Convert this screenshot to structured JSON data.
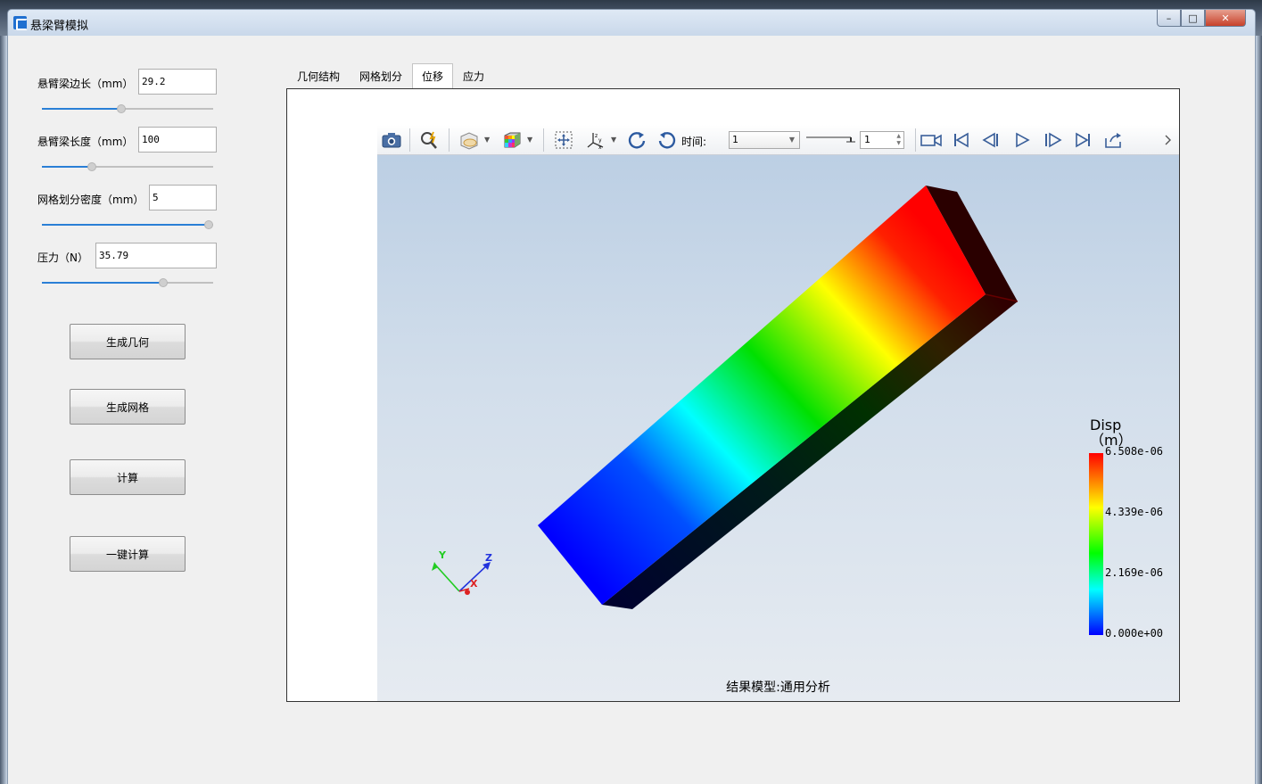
{
  "window": {
    "title": "悬梁臂模拟",
    "controls": {
      "minimize": "–",
      "maximize": "□",
      "close": "✕"
    }
  },
  "params": [
    {
      "label": "悬臂梁边长（mm）",
      "value": "29.2",
      "slider_fraction": 0.46
    },
    {
      "label": "悬臂梁长度（mm）",
      "value": "100",
      "slider_fraction": 0.28
    },
    {
      "label": "网格划分密度（mm）",
      "value": "5",
      "slider_fraction": 1.0
    },
    {
      "label": "压力（N）",
      "value": "35.79",
      "slider_fraction": 0.72
    }
  ],
  "buttons": {
    "gen_geometry": "生成几何",
    "gen_mesh": "生成网格",
    "compute": "计算",
    "one_click": "一键计算"
  },
  "tabs": [
    {
      "label": "几何结构",
      "active": false
    },
    {
      "label": "网格划分",
      "active": false
    },
    {
      "label": "位移",
      "active": true
    },
    {
      "label": "应力",
      "active": false
    }
  ],
  "toolbar": {
    "time_label": "时间:",
    "time_value": "1",
    "time_spin": "1"
  },
  "viewer": {
    "caption": "结果模型:通用分析",
    "axes": {
      "x": "X",
      "y": "Y",
      "z": "Z"
    }
  },
  "legend": {
    "title_line1": "Disp",
    "title_line2": "（m）",
    "ticks": [
      "6.508e-06",
      "4.339e-06",
      "2.169e-06",
      "0.000e+00"
    ],
    "colors": [
      "#ff0000",
      "#ffff00",
      "#00ff00",
      "#00ffff",
      "#0000ff"
    ]
  }
}
